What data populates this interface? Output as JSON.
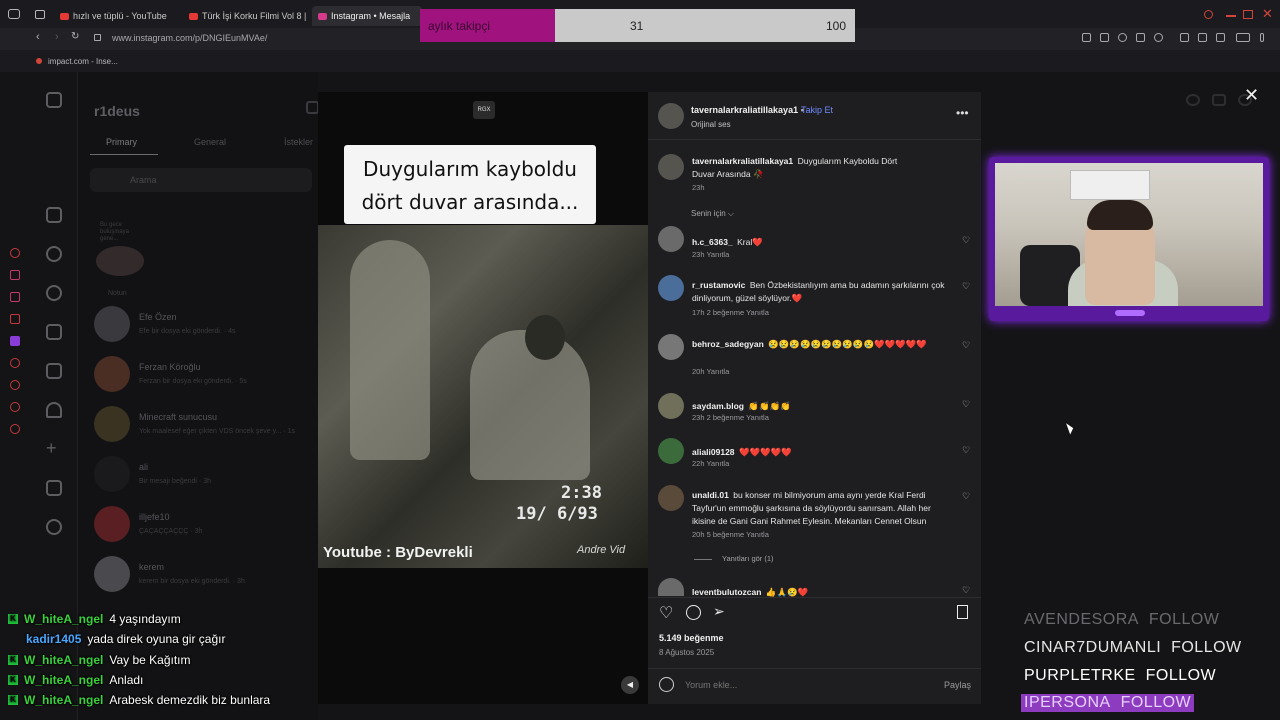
{
  "browser": {
    "tabs": [
      {
        "label": "hızlı ve tüplü - YouTube"
      },
      {
        "label": "Türk İşi Korku Filmi Vol 8 |"
      },
      {
        "label": "Instagram • Mesajla"
      }
    ],
    "url": "www.instagram.com/p/DNGIEunMVAe/",
    "bookmark": "impact.com - Inse..."
  },
  "follower_goal": {
    "label": "aylık takipçi",
    "current": "31",
    "goal": "100",
    "progress": 0.31,
    "fill_color": "#a0137e"
  },
  "dm": {
    "username": "r1deus",
    "tabs": [
      "Primary",
      "General",
      "İstekler"
    ],
    "search_placeholder": "Arama",
    "note": "Bu gece buluşmaya gene...",
    "note_label": "Notun",
    "conversations": [
      {
        "name": "Efe Özen",
        "msg": "Efe bir dosya eki gönderdi. · 4s"
      },
      {
        "name": "Ferzan Köroğlu",
        "msg": "Ferzan bir dosya eki gönderdi. · 5s"
      },
      {
        "name": "Minecraft sunucusu",
        "msg": "Yok maalesef eğer çikten VDS öncek şeve y... · 1s"
      },
      {
        "name": "ali",
        "msg": "Bir mesajı beğendi · 3h"
      },
      {
        "name": "illjefe10",
        "msg": "ÇAÇAÇÇAÇÇÇ · 3h"
      },
      {
        "name": "kerem",
        "msg": "kerem bir dosya eki gönderdi. · 3h"
      }
    ]
  },
  "reel": {
    "badge": "RGX",
    "caption_line1": "Duygularım kayboldu",
    "caption_line2": "dört duvar arasında...",
    "time": "2:38",
    "date": "19/ 6/93",
    "credit": "Youtube : ByDevrekli",
    "watermark": "Andre Vid"
  },
  "post": {
    "username": "tavernalarkraliatillakaya1",
    "dot": "•",
    "follow": "Takip Et",
    "audio": "Orijinal ses",
    "caption": "Duygularım Kayboldu Dört Duvar Arasında 🥀",
    "caption_time": "23h",
    "for_you": "Senin için ⌵",
    "comments": [
      {
        "user": "h.c_6363_",
        "text": "Kral❤️",
        "meta": "23h    Yanıtla"
      },
      {
        "user": "r_rustamovic",
        "text": "Ben Özbekistanlıyım ama bu adamın şarkılarını çok dinliyorum, güzel söylüyor.❤️",
        "meta": "17h    2 beğenme    Yanıtla"
      },
      {
        "user": "behroz_sadegyan",
        "text": "😢😢😢😢😢😢😢😢😢😢❤️❤️❤️❤️❤️",
        "meta": "20h    Yanıtla"
      },
      {
        "user": "saydam.blog",
        "text": "👏👏👏👏",
        "meta": "23h    2 beğenme    Yanıtla"
      },
      {
        "user": "aliali09128",
        "text": "❤️❤️❤️❤️❤️",
        "meta": "22h    Yanıtla"
      },
      {
        "user": "unaldi.01",
        "text": "bu konser mi bilmiyorum ama aynı yerde Kral Ferdi Tayfur'un emmoğlu şarkısına da söylüyordu sanırsam. Allah her ikisine de Gani Gani Rahmet Eylesin. Mekanları Cennet Olsun",
        "meta": "20h    5 beğenme    Yanıtla"
      },
      {
        "user": "leventbulutozcan",
        "text": "👍🙏😢❤️",
        "meta": ""
      }
    ],
    "replies": "Yanıtları gör (1)",
    "likes": "5.149 beğenme",
    "date": "8 Ağustos 2025",
    "comment_placeholder": "Yorum ekle...",
    "share": "Paylaş"
  },
  "follow_alerts": [
    {
      "name": "AVENDESORA",
      "action": "FOLLOW",
      "color": "#6a6a6e"
    },
    {
      "name": "CINAR7DUMANLI",
      "action": "FOLLOW",
      "color": "#e6e6e6"
    },
    {
      "name": "PURPLETRKE",
      "action": "FOLLOW",
      "color": "#ffffff"
    },
    {
      "name": "IPERSONA",
      "action": "FOLLOW",
      "color": "#e6d0ff"
    }
  ],
  "chat": [
    {
      "badge": "K",
      "user": "W_hiteA_ngel",
      "user_color": "#3ad13a",
      "text": "4 yaşındayım"
    },
    {
      "badge": "",
      "user": "kadir1405",
      "user_color": "#4aa6ff",
      "text": "yada direk oyuna gir çağır"
    },
    {
      "badge": "K",
      "user": "W_hiteA_ngel",
      "user_color": "#3ad13a",
      "text": "Vay be Kağıtım"
    },
    {
      "badge": "K",
      "user": "W_hiteA_ngel",
      "user_color": "#3ad13a",
      "text": "Anladı"
    },
    {
      "badge": "K",
      "user": "W_hiteA_ngel",
      "user_color": "#3ad13a",
      "text": "Arabesk demezdik biz bunlara"
    }
  ]
}
